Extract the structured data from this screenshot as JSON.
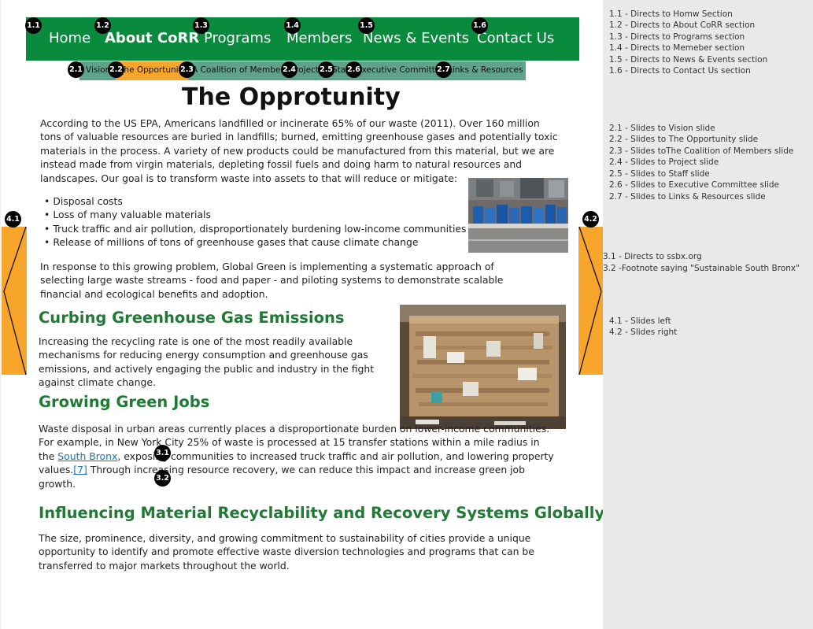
{
  "nav": {
    "items": [
      {
        "label": "Home",
        "active": false
      },
      {
        "label": "About CoRR",
        "active": true
      },
      {
        "label": "Programs",
        "active": false
      },
      {
        "label": "Members",
        "active": false
      },
      {
        "label": "News & Events",
        "active": false
      },
      {
        "label": "Contact Us",
        "active": false
      }
    ],
    "color": "#0a8a3c"
  },
  "subnav": {
    "items": [
      {
        "label": "Vision"
      },
      {
        "label": "The Opportunity",
        "active": true
      },
      {
        "label": "A Coalition of Members"
      },
      {
        "label": "Project"
      },
      {
        "label": "Staff"
      },
      {
        "label": "Executive Committee"
      },
      {
        "label": "Links & Resources"
      }
    ],
    "color": "#5fa48a",
    "active_color": "#f7a52b"
  },
  "badges": {
    "nav": [
      "1.1",
      "1.2",
      "1.3",
      "1.4",
      "1.5",
      "1.6"
    ],
    "subnav": [
      "2.1",
      "2.2",
      "2.3",
      "2.4",
      "2.5",
      "2.6",
      "2.7"
    ],
    "link": "3.1",
    "footnote": "3.2",
    "left": "4.1",
    "right": "4.2"
  },
  "content": {
    "title": "The Opprotunity",
    "intro": "According to the US EPA, Americans landfilled or incinerate 65% of our waste (2011). Over 160 million tons of valuable resources are buried in landfills; burned, emitting greenhouse gases and potentially toxic materials in the process. A variety of new products could be manufactured from this material, but we are instead made from virgin materials, depleting fossil fuels and doing harm to natural resources and landscapes. Our goal is to transform waste into assets to that will reduce or mitigate:",
    "bullets": [
      "Disposal costs",
      "Loss of many valuable materials",
      "Truck traffic and air pollution, disproportionately burdening low-income communities",
      "Release of millions of tons of greenhouse gases that cause climate change"
    ],
    "response": "In response to this growing problem, Global Green is implementing a systematic approach of selecting large waste streams - food and paper - and piloting systems to demonstrate scalable financial and ecological benefits and adoption.",
    "h_ghg": "Curbing Greenhouse Gas Emissions",
    "p_ghg": "Increasing the recycling rate is one of the most readily available mechanisms for reducing energy consumption and greenhouse gas emissions, and actively engaging the public and industry in the fight against climate change.",
    "h_jobs": "Growing Green Jobs",
    "p_jobs_before": "Waste disposal in urban areas currently places a disproportionate burden on lower-income communities. For example, in New York City 25% of waste is processed at 15 transfer stations within a mile radius in the ",
    "p_jobs_link": "South Bronx",
    "p_jobs_middle": ", exposing communities to increased truck traffic and air pollution, and lowering property values.",
    "p_jobs_footnote": "[7]",
    "p_jobs_after": " Through increasing resource recovery, we can reduce this impact and increase green job growth.",
    "h_global": "Influencing Material Recyclability and Recovery Systems Globally",
    "p_global": "The size, prominence, diversity, and growing commitment to sustainability of cities provide a unique opportunity to identify and promote effective waste diversion technologies and programs that can be transferred to major markets throughout the world."
  },
  "notes": {
    "group1": [
      "1.1 - Directs to Homw Section",
      "1.2 - Directs to About CoRR section",
      "1.3 - Directs to Programs section",
      "1.4 - Directs to Memeber section",
      "1.5  - Directs to News & Events section",
      "1.6  - Directs to Contact Us section"
    ],
    "group2": [
      "2.1 - Slides to Vision slide",
      "2.2 - Slides to The Opportunity slide",
      "2.3 - Slides toThe Coalition of Members slide",
      "2.4 - Slides to Project slide",
      "2.5 - Slides to Staff slide",
      "2.6 - Slides to Executive Committee slide",
      "2.7 - Slides to Links & Resources slide"
    ],
    "group3": [
      "3.1 - Directs to ssbx.org",
      "3.2  -Footnote saying \"Sustainable South Bronx\""
    ],
    "group4": [
      "4.1 - Slides left",
      "4.2 - Slides right"
    ]
  }
}
